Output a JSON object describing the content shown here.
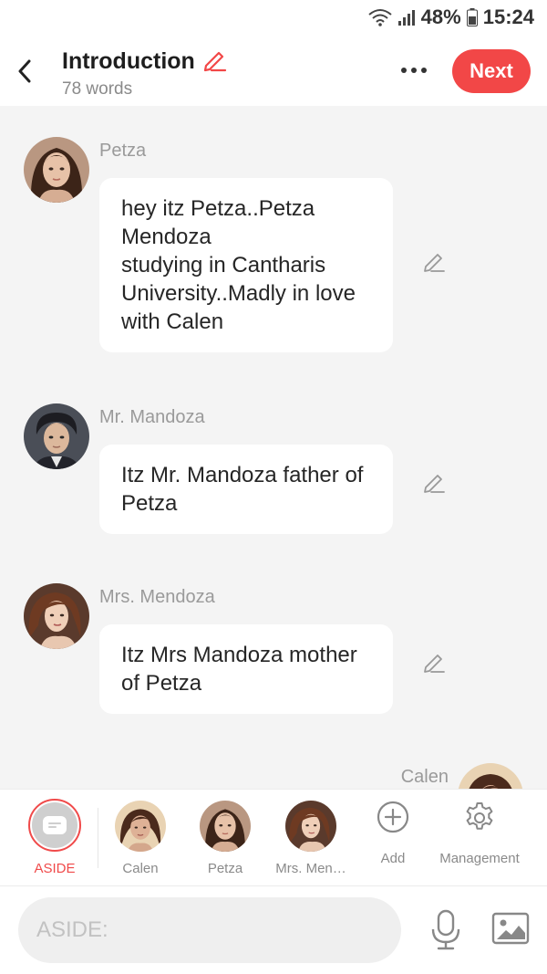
{
  "status_bar": {
    "battery": "48%",
    "time": "15:24"
  },
  "header": {
    "title": "Introduction",
    "word_count": "78 words",
    "next_label": "Next"
  },
  "messages": [
    {
      "sender": "Petza",
      "text": "hey itz Petza..Petza Mendoza\nstudying in Cantharis University..Madly in love with Calen"
    },
    {
      "sender": "Mr. Mandoza",
      "text": "Itz Mr. Mandoza father of Petza"
    },
    {
      "sender": "Mrs. Mendoza",
      "text": "Itz Mrs Mandoza mother of Petza"
    },
    {
      "sender": "Calen",
      "text": ""
    }
  ],
  "characters": [
    {
      "label": "ASIDE",
      "selected": true
    },
    {
      "label": "Calen"
    },
    {
      "label": "Petza"
    },
    {
      "label": "Mrs. Men…"
    },
    {
      "label": "Add"
    },
    {
      "label": "Management"
    }
  ],
  "input": {
    "placeholder": "ASIDE:",
    "value": ""
  },
  "colors": {
    "accent": "#f24747",
    "background": "#f4f4f4"
  }
}
